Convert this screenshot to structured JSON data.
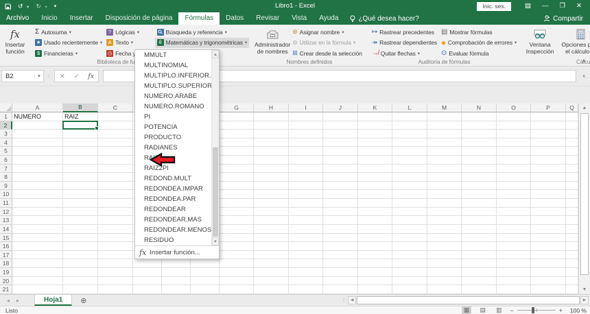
{
  "titlebar": {
    "title": "Libro1 - Excel",
    "signin_label": "Inic. ses."
  },
  "menu": {
    "tabs": [
      {
        "label": "Archivo",
        "state": "file"
      },
      {
        "label": "Inicio"
      },
      {
        "label": "Insertar"
      },
      {
        "label": "Disposición de página"
      },
      {
        "label": "Fórmulas",
        "state": "selected"
      },
      {
        "label": "Datos"
      },
      {
        "label": "Revisar"
      },
      {
        "label": "Vista"
      },
      {
        "label": "Ayuda"
      }
    ],
    "tell_me": "¿Qué desea hacer?",
    "share_label": "Compartir"
  },
  "ribbon": {
    "insert_function": {
      "label": "Insertar función"
    },
    "library": {
      "autosuma": "Autosuma",
      "usado": "Usado recientemente",
      "financieras": "Financieras",
      "logicas": "Lógicas",
      "texto": "Texto",
      "fecha": "Fecha y hora",
      "busqueda": "Búsqueda y referencia",
      "matematicas": "Matemáticas y trigonométricas",
      "group_label": "Biblioteca de funciones"
    },
    "names": {
      "administrador": "Administrador de nombres",
      "asignar": "Asignar nombre",
      "utilizar": "Utilizar en la fórmula",
      "crear": "Crear desde la selección",
      "group_label": "Nombres definidos"
    },
    "audit": {
      "precedentes": "Rastrear precedentes",
      "dependientes": "Rastrear dependientes",
      "quitar": "Quitar flechas",
      "mostrar": "Mostrar fórmulas",
      "comprobacion": "Comprobación de errores",
      "evaluar": "Evaluar fórmula",
      "group_label": "Auditoría de fórmulas"
    },
    "watch": {
      "label": "Ventana Inspección"
    },
    "calc": {
      "opciones": "Opciones para el cálculo",
      "group_label": "Cálculo"
    }
  },
  "formula_bar": {
    "name_box": "B2"
  },
  "dropdown": {
    "items": [
      "MMULT",
      "MULTINOMIAL",
      "MULTIPLO.INFERIOR.MAT",
      "MULTIPLO.SUPERIOR.MAT",
      "NUMERO.ARABE",
      "NUMERO.ROMANO",
      "PI",
      "POTENCIA",
      "PRODUCTO",
      "RADIANES",
      "RAIZ",
      "RAIZ2PI",
      "REDOND.MULT",
      "REDONDEA.IMPAR",
      "REDONDEA.PAR",
      "REDONDEAR",
      "REDONDEAR.MAS",
      "REDONDEAR.MENOS",
      "RESIDUO"
    ],
    "footer": "Insertar función...",
    "arrow_target": "RAIZ"
  },
  "grid": {
    "columns": [
      "A",
      "B",
      "C",
      "D",
      "E",
      "F",
      "G",
      "H",
      "I",
      "J",
      "K",
      "L",
      "M",
      "N",
      "O",
      "P",
      "Q"
    ],
    "visible_rows": 21,
    "cells": {
      "A1": "NUMERO",
      "B1": "RAIZ"
    },
    "selected_cell": "B2",
    "selected_col": "B",
    "selected_row": 2
  },
  "sheetbar": {
    "tabs": [
      "Hoja1"
    ],
    "active_tab": "Hoja1"
  },
  "statusbar": {
    "mode": "Listo",
    "zoom": "100 %"
  },
  "colors": {
    "accent": "#217346",
    "arrow_red": "#ec1c24"
  }
}
